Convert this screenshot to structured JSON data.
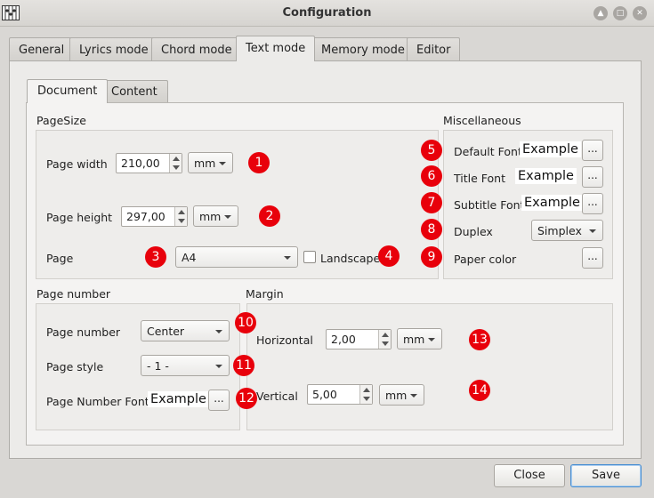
{
  "window": {
    "title": "Configuration",
    "buttons": [
      "▲",
      "□",
      "✕"
    ]
  },
  "tabs": [
    "General",
    "Lyrics mode",
    "Chord mode",
    "Text mode",
    "Memory mode",
    "Editor"
  ],
  "active_tab": "Text mode",
  "subtabs": [
    "Document",
    "Content"
  ],
  "active_subtab": "Document",
  "page_size": {
    "title": "PageSize",
    "width_label": "Page width",
    "width_value": "210,00",
    "width_unit": "mm",
    "height_label": "Page height",
    "height_value": "297,00",
    "height_unit": "mm",
    "page_label": "Page",
    "page_value": "A4",
    "landscape_label": "Landscape"
  },
  "misc": {
    "title": "Miscellaneous",
    "default_font_label": "Default Font",
    "default_font_example": "Example",
    "title_font_label": "Title Font",
    "title_font_example": "Example",
    "subtitle_font_label": "Subtitle Font",
    "subtitle_font_example": "Example",
    "duplex_label": "Duplex",
    "duplex_value": "Simplex",
    "paper_color_label": "Paper color",
    "dots": "..."
  },
  "page_number": {
    "title": "Page number",
    "number_label": "Page number",
    "number_value": "Center",
    "style_label": "Page style",
    "style_value": "- 1 -",
    "font_label": "Page Number  Font",
    "font_example": "Example"
  },
  "margin": {
    "title": "Margin",
    "horizontal_label": "Horizontal",
    "horizontal_value": "2,00",
    "horizontal_unit": "mm",
    "vertical_label": "Vertical",
    "vertical_value": "5,00",
    "vertical_unit": "mm"
  },
  "badges": [
    "1",
    "2",
    "3",
    "4",
    "5",
    "6",
    "7",
    "8",
    "9",
    "10",
    "11",
    "12",
    "13",
    "14"
  ],
  "footer": {
    "close_label": "Close",
    "save_label": "Save"
  },
  "colors": {
    "badge": "#e8000b",
    "accent": "#4a8fd1"
  }
}
